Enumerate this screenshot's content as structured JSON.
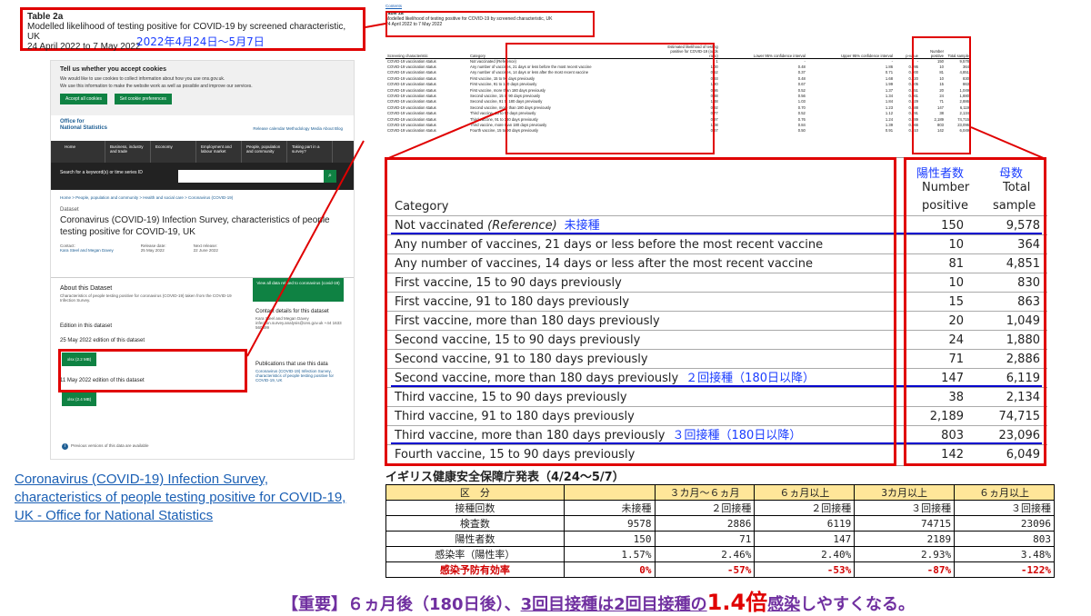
{
  "title_box": {
    "table_label": "Table 2a",
    "heading": "Modelled likelihood of testing positive for COVID-19 by screened characteristic, UK",
    "period": "24 April 2022 to 7 May 2022",
    "period_jp": "2022年4月24日～5月7日"
  },
  "ons_page": {
    "cookie_title": "Tell us whether you accept cookies",
    "cookie_text1": "We would like to use cookies to collect information about how you use ons.gov.uk.",
    "cookie_text2": "We use this information to make the website work as well as possible and improve our services.",
    "accept_label": "Accept all cookies",
    "prefs_label": "Set cookie preferences",
    "logo_line1": "Office for",
    "logo_line2": "National Statistics",
    "header_links": "Release calendar   Methodology   Media   About   Blog",
    "nav": [
      "Home",
      "Business, industry and trade",
      "Economy",
      "Employment and labour market",
      "People, population and community",
      "Taking part in a survey?"
    ],
    "search_label": "Search for a keyword(s) or time series ID",
    "breadcrumb": "Home > People, population and community > Health and social care > Coronavirus (COVID-19)",
    "dataset_label": "Dataset",
    "dataset_title": "Coronavirus (COVID-19) Infection Survey, characteristics of people testing positive for COVID-19, UK",
    "contact_label": "Contact:",
    "contact_value": "Kara Steel and Megan Davey",
    "release_label": "Release date:",
    "release_value": "25 May 2022",
    "next_label": "Next release:",
    "next_value": "22 June 2022",
    "about_title": "About this Dataset",
    "about_text": "Characteristics of people testing positive for coronavirus (COVID-19) taken from the COVID-19 Infection Survey.",
    "edition_heading": "Edition in this dataset",
    "edition1": "25 May 2022 edition of this dataset",
    "edition1_btn": "xlsx (2.2 MB)",
    "edition2": "11 May 2022 edition of this dataset",
    "edition2_btn": "xlsx (2.4 MB)",
    "view_all": "View all data related to coronavirus (covid-19)",
    "contact_details_title": "Contact details for this dataset",
    "contact_details_text": "Kara Steel and Megan Davey infection.survey.analysis@ons.gov.uk +44 1633 560499",
    "publications_title": "Publications that use this data",
    "publications_text": "Coronavirus (COVID-19) Infection Survey, characteristics of people testing positive for COVID-19, UK",
    "previous_versions": "Previous versions of this data are available"
  },
  "link_text": "Coronavirus (COVID-19) Infection Survey, characteristics of people testing positive for COVID-19, UK - Office for National Statistics",
  "sheet": {
    "contents": "Contents",
    "table_label": "Table 2a",
    "heading": "Modelled likelihood of testing positive for COVID-19 by screened characteristic, UK",
    "period": "24 April 2022 to 7 May 2022",
    "headers": [
      "Screening characteristic",
      "Category",
      "Estimated likelihood of testing positive for COVID-19 (odds ratio)",
      "Lower 95% confidence interval",
      "Upper 95% confidence interval",
      "p-value",
      "Number positive",
      "Total sample"
    ],
    "rows": [
      [
        "COVID-19 vaccination status",
        "Not vaccinated (Reference)",
        "1",
        "-",
        "-",
        "-",
        "150",
        "9,578"
      ],
      [
        "COVID-19 vaccination status",
        "Any number of vaccines, 21 days or less before the most recent vaccine",
        "1.00",
        "0.48",
        "1.86",
        "0.995",
        "10",
        "364"
      ],
      [
        "COVID-19 vaccination status",
        "Any number of vaccines, 14 days or less after the most recent vaccine",
        "0.52",
        "0.37",
        "0.71",
        "0.000",
        "81",
        "4,851"
      ],
      [
        "COVID-19 vaccination status",
        "First vaccine, 15 to 90 days previously",
        "0.93",
        "0.48",
        "1.68",
        "0.820",
        "10",
        "830"
      ],
      [
        "COVID-19 vaccination status",
        "First vaccine, 91 to 180 days previously",
        "1.20",
        "0.67",
        "1.99",
        "0.505",
        "15",
        "863"
      ],
      [
        "COVID-19 vaccination status",
        "First vaccine, more than 180 days previously",
        "0.86",
        "0.52",
        "1.37",
        "0.551",
        "20",
        "1,049"
      ],
      [
        "COVID-19 vaccination status",
        "Second vaccine, 15 to 90 days previously",
        "0.88",
        "0.56",
        "1.34",
        "0.561",
        "24",
        "1,880"
      ],
      [
        "COVID-19 vaccination status",
        "Second vaccine, 91 to 180 days previously",
        "1.38",
        "1.03",
        "1.84",
        "0.029",
        "71",
        "2,886"
      ],
      [
        "COVID-19 vaccination status",
        "Second vaccine, more than 180 days previously",
        "0.92",
        "0.70",
        "1.23",
        "0.588",
        "147",
        "6,119"
      ],
      [
        "COVID-19 vaccination status",
        "Third vaccine, 15 to 90 days previously",
        "0.77",
        "0.52",
        "1.12",
        "0.191",
        "38",
        "2,134"
      ],
      [
        "COVID-19 vaccination status",
        "Third vaccine, 91 to 180 days previously",
        "0.97",
        "0.76",
        "1.24",
        "0.789",
        "2,189",
        "74,715"
      ],
      [
        "COVID-19 vaccination status",
        "Third vaccine, more than 180 days previously",
        "1.08",
        "0.84",
        "1.39",
        "0.566",
        "803",
        "23,096"
      ],
      [
        "COVID-19 vaccination status",
        "Fourth vaccine, 15 to 90 days previously",
        "0.67",
        "0.50",
        "0.91",
        "0.010",
        "142",
        "6,049"
      ]
    ]
  },
  "zoom": {
    "category_header": "Category",
    "np_jp": "陽性者数",
    "ts_jp": "母数",
    "np_header1": "Number",
    "np_header2": "positive",
    "ts_header1": "Total",
    "ts_header2": "sample",
    "rows": [
      {
        "cat": "Not vaccinated ",
        "ref": "(Reference)",
        "jp": "未接種",
        "np": "150",
        "ts": "9,578"
      },
      {
        "cat": "Any number of vaccines, 21 days or less before the most recent vaccine",
        "ref": "",
        "jp": "",
        "np": "10",
        "ts": "364"
      },
      {
        "cat": "Any number of vaccines, 14 days or less after the most recent vaccine",
        "ref": "",
        "jp": "",
        "np": "81",
        "ts": "4,851"
      },
      {
        "cat": "First vaccine, 15 to 90 days previously",
        "ref": "",
        "jp": "",
        "np": "10",
        "ts": "830"
      },
      {
        "cat": "First vaccine, 91 to 180 days previously",
        "ref": "",
        "jp": "",
        "np": "15",
        "ts": "863"
      },
      {
        "cat": "First vaccine, more than 180 days previously",
        "ref": "",
        "jp": "",
        "np": "20",
        "ts": "1,049"
      },
      {
        "cat": "Second vaccine, 15 to 90 days previously",
        "ref": "",
        "jp": "",
        "np": "24",
        "ts": "1,880"
      },
      {
        "cat": "Second vaccine, 91 to 180 days previously",
        "ref": "",
        "jp": "",
        "np": "71",
        "ts": "2,886"
      },
      {
        "cat": "Second vaccine, more than 180 days previously",
        "ref": "",
        "jp": "２回接種（180日以降）",
        "np": "147",
        "ts": "6,119"
      },
      {
        "cat": "Third vaccine, 15 to 90 days previously",
        "ref": "",
        "jp": "",
        "np": "38",
        "ts": "2,134"
      },
      {
        "cat": "Third vaccine, 91 to 180 days previously",
        "ref": "",
        "jp": "",
        "np": "2,189",
        "ts": "74,715"
      },
      {
        "cat": "Third vaccine, more than 180 days previously",
        "ref": "",
        "jp": "３回接種（180日以降）",
        "np": "803",
        "ts": "23,096"
      },
      {
        "cat": "Fourth vaccine, 15 to 90 days previously",
        "ref": "",
        "jp": "",
        "np": "142",
        "ts": "6,049"
      }
    ]
  },
  "ukhsa": {
    "title": "イギリス健康安全保障庁発表（4/24～5/7）",
    "header": [
      "区　分",
      "",
      "３カ月～６ヵ月",
      "６ヵ月以上",
      "3カ月以上",
      "６ヵ月以上"
    ],
    "doses": [
      "接種回数",
      "未接種",
      "２回接種",
      "２回接種",
      "３回接種",
      "３回接種"
    ],
    "tests": [
      "検査数",
      "9578",
      "2886",
      "6119",
      "74715",
      "23096"
    ],
    "positives": [
      "陽性者数",
      "150",
      "71",
      "147",
      "2189",
      "803"
    ],
    "rate": [
      "感染率（陽性率）",
      "1.57%",
      "2.46%",
      "2.40%",
      "2.93%",
      "3.48%"
    ],
    "efficacy": [
      "感染予防有効率",
      "0%",
      "-57%",
      "-53%",
      "-87%",
      "-122%"
    ]
  },
  "conclusion": {
    "p1": "【重要】６ヵ月後（180日後）、",
    "p2": "3回目接種は2回目接種の",
    "p3": "1.4倍",
    "p4": "感染",
    "p5": "しやすくなる。"
  },
  "colors": {
    "highlight_red": "#e00000",
    "blue_text": "#1a3cff",
    "ons_green": "#0f8243",
    "header_yellow": "#ffe699",
    "purple": "#7030a0"
  }
}
